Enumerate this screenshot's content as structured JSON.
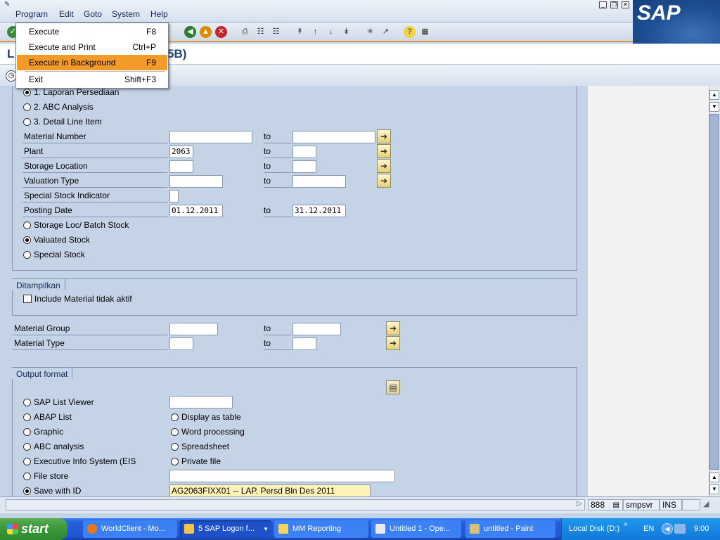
{
  "menubar": {
    "items": [
      {
        "label": "Program",
        "icon": "program-menu-icon"
      },
      {
        "label": "Edit"
      },
      {
        "label": "Goto"
      },
      {
        "label": "System"
      },
      {
        "label": "Help"
      }
    ],
    "logo": "SAP"
  },
  "dropdown": {
    "items": [
      {
        "label": "Execute",
        "shortcut": "F8"
      },
      {
        "label": "Execute and Print",
        "shortcut": "Ctrl+P"
      },
      {
        "label": "Execute in Background",
        "shortcut": "F9",
        "selected": true
      },
      {
        "label": "Exit",
        "shortcut": "Shift+F3"
      }
    ],
    "highlight_color": "#f49a28"
  },
  "title": {
    "left": "L",
    "right": "5B)"
  },
  "report_options": [
    {
      "label": "1. Laporan Persediaan",
      "selected": true
    },
    {
      "label": "2. ABC Analysis",
      "selected": false
    },
    {
      "label": "3. Detail Line Item",
      "selected": false
    }
  ],
  "selection_fields": [
    {
      "label": "Material Number",
      "from": "",
      "to_label": "to",
      "to": "",
      "has_more": true
    },
    {
      "label": "Plant",
      "from": "2063",
      "to_label": "to",
      "to": "",
      "has_more": true
    },
    {
      "label": "Storage Location",
      "from": "",
      "to_label": "to",
      "to": "",
      "has_more": true
    },
    {
      "label": "Valuation Type",
      "from": "",
      "to_label": "to",
      "to": "",
      "has_more": true
    },
    {
      "label": "Special Stock Indicator",
      "from": ""
    },
    {
      "label": "Posting Date",
      "from": "01.12.2011",
      "to_label": "to",
      "to": "31.12.2011"
    }
  ],
  "stock_options": [
    {
      "label": "Storage Loc/ Batch Stock",
      "selected": false
    },
    {
      "label": "Valuated Stock",
      "selected": true
    },
    {
      "label": "Special Stock",
      "selected": false
    }
  ],
  "ditampilkan": {
    "title": "Ditampilkan",
    "checkbox_label": "Include Material tidak aktif",
    "checked": false
  },
  "material_fields": [
    {
      "label": "Material Group",
      "from": "",
      "to_label": "to",
      "to": ""
    },
    {
      "label": "Material Type",
      "from": "",
      "to_label": "to",
      "to": ""
    }
  ],
  "output_format": {
    "title": "Output format",
    "left_options": [
      {
        "label": "SAP List Viewer",
        "selected": false
      },
      {
        "label": "ABAP List",
        "selected": false
      },
      {
        "label": "Graphic",
        "selected": false
      },
      {
        "label": "ABC analysis",
        "selected": false
      },
      {
        "label": "Executive Info System (EIS",
        "selected": false
      },
      {
        "label": "File store",
        "selected": false
      },
      {
        "label": "Save with ID",
        "selected": true
      }
    ],
    "right_options": [
      {
        "label": "Display as table",
        "selected": false
      },
      {
        "label": "Word processing",
        "selected": false
      },
      {
        "label": "Spreadsheet",
        "selected": false
      },
      {
        "label": "Private file",
        "selected": false
      }
    ],
    "save_with_id_value": "AG2063FIXX01 -- LAP. Persd Bln Des 2011"
  },
  "statusbar": {
    "session": "888",
    "server": "smpsvr",
    "mode": "INS"
  },
  "taskbar": {
    "start": "start",
    "buttons": [
      {
        "label": "WorldClient - Mo...",
        "icon": "firefox-icon"
      },
      {
        "label": "5 SAP Logon f...",
        "icon": "sap-logon-icon",
        "active": true
      },
      {
        "label": "MM Reporting",
        "icon": "folder-icon"
      },
      {
        "label": "Untitled 1 - Ope...",
        "icon": "writer-icon"
      },
      {
        "label": "untitled - Paint",
        "icon": "paint-icon"
      }
    ],
    "tray_drive": "Local Disk (D:)",
    "language": "EN",
    "clock": "9:00"
  }
}
